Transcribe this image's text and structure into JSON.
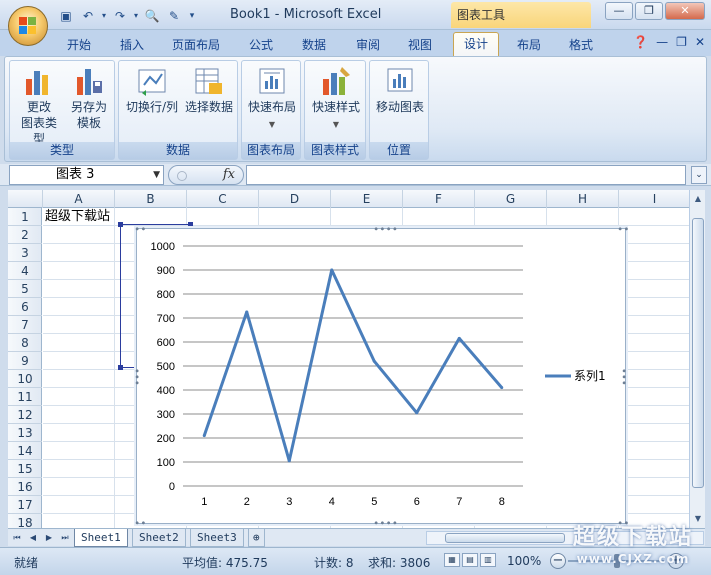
{
  "window": {
    "title": "Book1 - Microsoft Excel",
    "tool_context": "图表工具"
  },
  "qat": {
    "save_icon": "save-icon",
    "undo_icon": "undo-icon",
    "redo_icon": "redo-icon",
    "customize": "▾"
  },
  "tabs": [
    {
      "label": "开始"
    },
    {
      "label": "插入"
    },
    {
      "label": "页面布局"
    },
    {
      "label": "公式"
    },
    {
      "label": "数据"
    },
    {
      "label": "审阅"
    },
    {
      "label": "视图"
    },
    {
      "label": "设计"
    },
    {
      "label": "布局"
    },
    {
      "label": "格式"
    }
  ],
  "ribbon": {
    "groups": {
      "type": {
        "label": "类型",
        "change_type": "更改\n图表类型",
        "save_template": "另存为\n模板"
      },
      "data": {
        "label": "数据",
        "switch_row_col": "切换行/列",
        "select_data": "选择数据"
      },
      "layout": {
        "label": "图表布局",
        "quick_layout": "快速布局"
      },
      "styles": {
        "label": "图表样式",
        "quick_style": "快速样式"
      },
      "location": {
        "label": "位置",
        "move_chart": "移动图表"
      }
    }
  },
  "formula_bar": {
    "name_box": "图表 3",
    "fx": "fx",
    "formula": ""
  },
  "sheet": {
    "columns": [
      "A",
      "B",
      "C",
      "D",
      "E",
      "F",
      "G",
      "H",
      "I"
    ],
    "rows": [
      "1",
      "2",
      "3",
      "4",
      "5",
      "6",
      "7",
      "8",
      "9",
      "10",
      "11",
      "12",
      "13",
      "14",
      "15",
      "16",
      "17",
      "18"
    ],
    "cell_a1": "超级下载站"
  },
  "chart_data": {
    "type": "line",
    "categories": [
      1,
      2,
      3,
      4,
      5,
      6,
      7,
      8
    ],
    "series": [
      {
        "name": "系列1",
        "values": [
          210,
          725,
          105,
          900,
          520,
          305,
          615,
          410
        ],
        "color": "#4a7ebb"
      }
    ],
    "ylim": [
      0,
      1000
    ],
    "yticks": [
      0,
      100,
      200,
      300,
      400,
      500,
      600,
      700,
      800,
      900,
      1000
    ],
    "grid": true,
    "legend": "right"
  },
  "sheet_tabs": [
    {
      "label": "Sheet1"
    },
    {
      "label": "Sheet2"
    },
    {
      "label": "Sheet3"
    }
  ],
  "status": {
    "ready": "就绪",
    "average": "平均值: 475.75",
    "count": "计数: 8",
    "sum": "求和: 3806",
    "zoom": "100%"
  },
  "watermark": {
    "line1": "超级下载站",
    "line2": "www.CJXZ.com"
  },
  "colors": {
    "accent": "#15428b",
    "series": "#4a7ebb"
  }
}
